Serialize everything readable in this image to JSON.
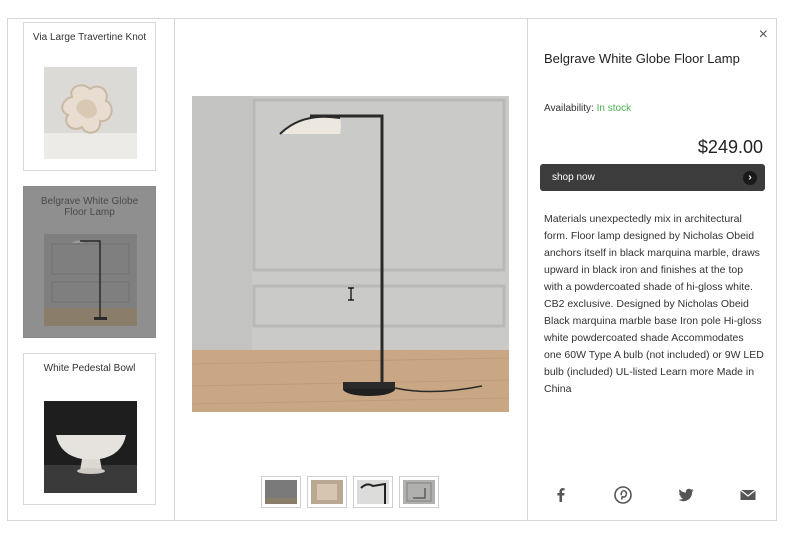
{
  "sidebar": {
    "items": [
      {
        "label": "Via Large Travertine Knot"
      },
      {
        "label": "Belgrave White Globe Floor Lamp"
      },
      {
        "label": "White Pedestal Bowl"
      }
    ]
  },
  "product": {
    "title": "Belgrave White Globe Floor Lamp",
    "availability_label": "Availability: ",
    "availability_status": "In stock",
    "price": "$249.00",
    "shop_label": "shop now",
    "description": "Materials unexpectedly mix in architectural form. Floor lamp designed by Nicholas Obeid anchors itself in black marquina marble, draws upward in black iron and finishes at the top with a powdercoated shade of hi-gloss white. CB2 exclusive. Designed by Nicholas Obeid  Black marquina marble base  Iron pole  Hi-gloss white powdercoated shade  Accommodates one 60W Type A bulb (not included) or 9W LED bulb (included)  UL-listed  Learn more Made in China"
  },
  "close_label": "×",
  "icons": [
    "close-icon",
    "facebook-icon",
    "pinterest-icon",
    "twitter-icon",
    "email-icon",
    "chevron-right-icon",
    "text-cursor-icon"
  ],
  "colors": {
    "in_stock": "#4caf50",
    "shop_button": "#3c3c3c",
    "active_card": "#8f8f8f"
  }
}
